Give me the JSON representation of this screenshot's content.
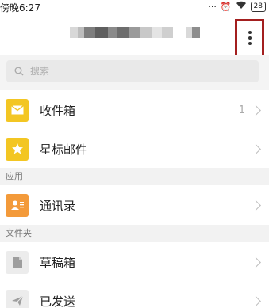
{
  "status": {
    "time": "傍晚6:27",
    "battery": "28"
  },
  "header": {
    "more_icon": "more-vertical-icon"
  },
  "search": {
    "placeholder": "搜索"
  },
  "mailbox": [
    {
      "label": "收件箱",
      "count": "1",
      "icon": "inbox-icon",
      "color": "#f3c623"
    },
    {
      "label": "星标邮件",
      "count": "",
      "icon": "star-icon",
      "color": "#f3c623"
    }
  ],
  "sections": {
    "apps": "应用",
    "folders": "文件夹"
  },
  "apps": [
    {
      "label": "通讯录",
      "icon": "contacts-icon",
      "color": "#f39a3a"
    }
  ],
  "folders": [
    {
      "label": "草稿箱",
      "icon": "draft-icon",
      "color": "#e9e9e9"
    },
    {
      "label": "已发送",
      "icon": "sent-icon",
      "color": "#e9e9e9"
    }
  ],
  "colors": {
    "highlight_border": "#a31f1f",
    "section_bg": "#f2f2f2"
  }
}
